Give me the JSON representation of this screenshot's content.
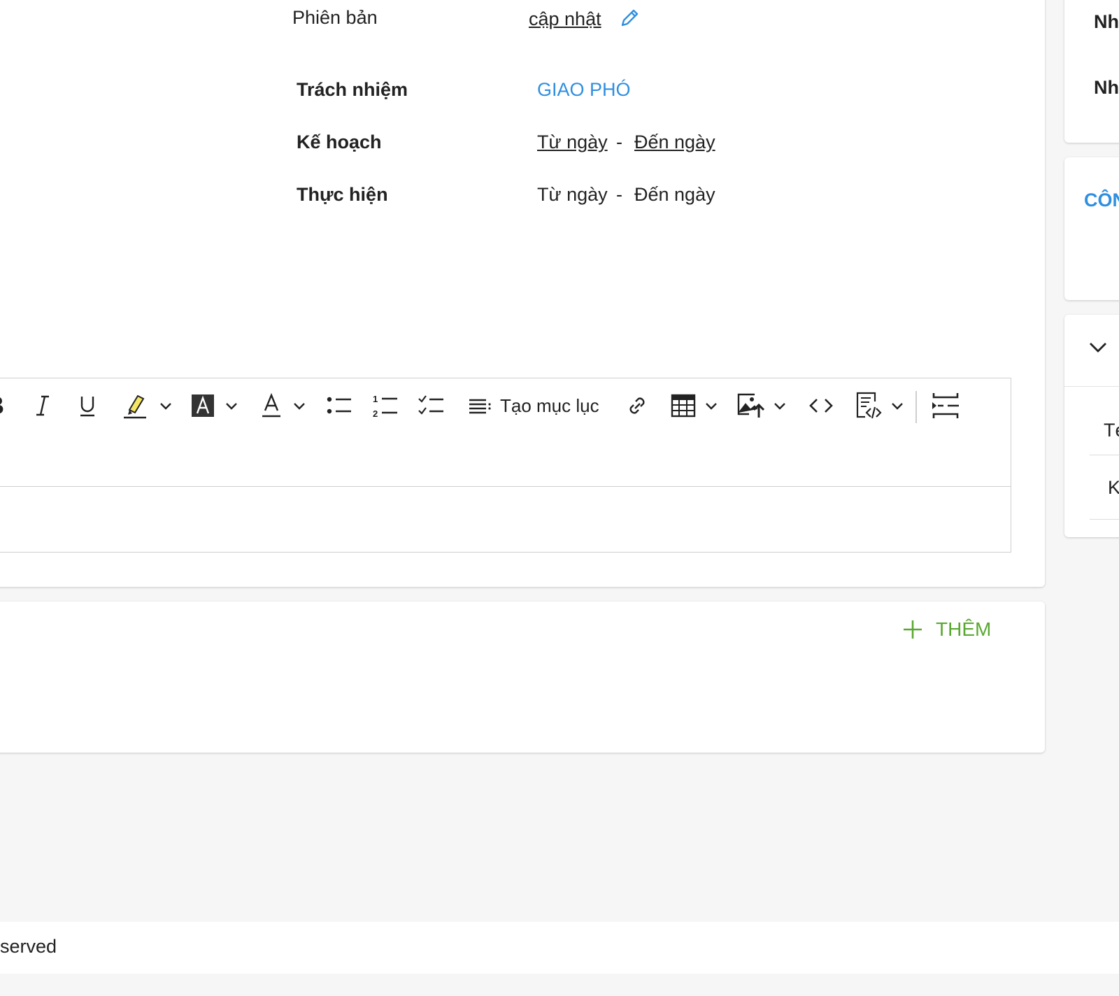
{
  "details": {
    "version_label": "Phiên bản",
    "version_value": "cập nhật",
    "responsibility_label": "Trách nhiệm",
    "responsibility_value": "GIAO PHÓ",
    "plan_label": "Kế hoạch",
    "plan_from": "Từ ngày",
    "plan_to": "Đến ngày",
    "execution_label": "Thực hiện",
    "execution_from": "Từ ngày",
    "execution_to": "Đến ngày",
    "date_separator": "-"
  },
  "toolbar": {
    "bold_label": "B",
    "toc_label": "Tạo mục lục",
    "icons": [
      "bold-icon",
      "italic-icon",
      "underline-icon",
      "highlight-icon",
      "font-background-icon",
      "font-color-icon",
      "bulleted-list-icon",
      "numbered-list-icon",
      "todo-list-icon",
      "table-of-contents-icon",
      "link-icon",
      "table-icon",
      "insert-image-icon",
      "code-icon",
      "source-editing-icon",
      "page-break-icon"
    ]
  },
  "add_section": {
    "add_label": "THÊM"
  },
  "right_panel": {
    "item1": "Nh",
    "item2": "Nh",
    "section_title": "CÔN",
    "row1": "Té",
    "row2": "K"
  },
  "footer": {
    "text": "served"
  },
  "colors": {
    "link_blue": "#2f8fe0",
    "add_green": "#5aa832",
    "highlight_yellow": "#f5e663"
  }
}
